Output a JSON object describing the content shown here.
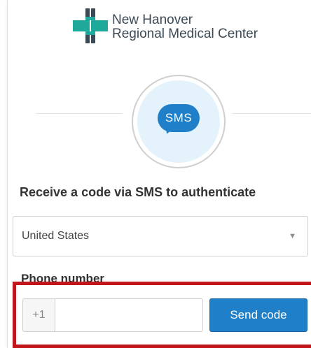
{
  "logo": {
    "line1": "New Hanover",
    "line2": "Regional Medical Center",
    "colors": {
      "teal": "#1fa99a",
      "navy": "#3b4a55"
    }
  },
  "method": {
    "badge_text": "SMS",
    "badge_color": "#1f7fc9",
    "icon": "sms-bubble-icon"
  },
  "heading": "Receive a code via SMS to authenticate",
  "country": {
    "selected": "United States",
    "caret": "▼"
  },
  "phone": {
    "label": "Phone number",
    "prefix": "+1",
    "value": "",
    "placeholder": ""
  },
  "actions": {
    "send_code": "Send code"
  },
  "annotation_color": "#c0161c"
}
